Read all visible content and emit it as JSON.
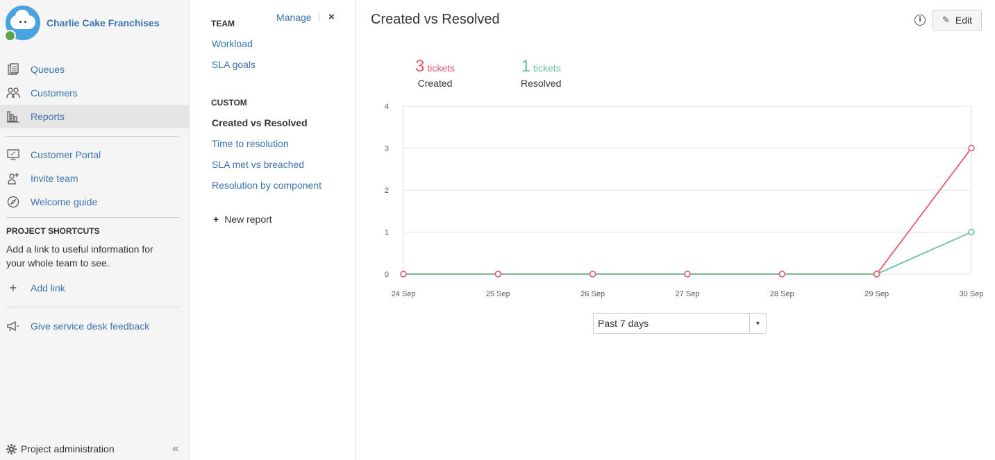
{
  "project": {
    "name": "Charlie Cake Franchises"
  },
  "sidebar": {
    "items": [
      {
        "label": "Queues",
        "icon": "queues-icon"
      },
      {
        "label": "Customers",
        "icon": "customers-icon"
      },
      {
        "label": "Reports",
        "icon": "reports-icon"
      },
      {
        "label": "Customer Portal",
        "icon": "portal-icon"
      },
      {
        "label": "Invite team",
        "icon": "invite-icon"
      },
      {
        "label": "Welcome guide",
        "icon": "compass-icon"
      }
    ],
    "shortcuts_title": "PROJECT SHORTCUTS",
    "shortcuts_desc": "Add a link to useful information for your whole team to see.",
    "add_link": "Add link",
    "feedback": "Give service desk feedback",
    "footer": "Project administration",
    "collapse": "«"
  },
  "reports_panel": {
    "team_title": "TEAM",
    "manage": "Manage",
    "close": "×",
    "team_links": [
      "Workload",
      "SLA goals"
    ],
    "custom_title": "CUSTOM",
    "custom_links": [
      "Created vs Resolved",
      "Time to resolution",
      "SLA met vs breached",
      "Resolution by component"
    ],
    "new_report": "New report"
  },
  "main": {
    "title": "Created vs Resolved",
    "edit": "Edit",
    "created": {
      "count": "3",
      "unit": "tickets",
      "label": "Created",
      "color": "#e8566c"
    },
    "resolved": {
      "count": "1",
      "unit": "tickets",
      "label": "Resolved",
      "color": "#6cbf98"
    },
    "range": "Past 7 days"
  },
  "chart_data": {
    "type": "line",
    "categories": [
      "24 Sep",
      "25 Sep",
      "26 Sep",
      "27 Sep",
      "28 Sep",
      "29 Sep",
      "30 Sep"
    ],
    "series": [
      {
        "name": "Created",
        "color": "#e8566c",
        "values": [
          0,
          0,
          0,
          0,
          0,
          0,
          3
        ]
      },
      {
        "name": "Resolved",
        "color": "#6cbf98",
        "values": [
          0,
          0,
          0,
          0,
          0,
          0,
          1
        ]
      }
    ],
    "yticks": [
      0,
      1,
      2,
      3,
      4
    ],
    "ylim": [
      0,
      4
    ],
    "grid": true
  }
}
